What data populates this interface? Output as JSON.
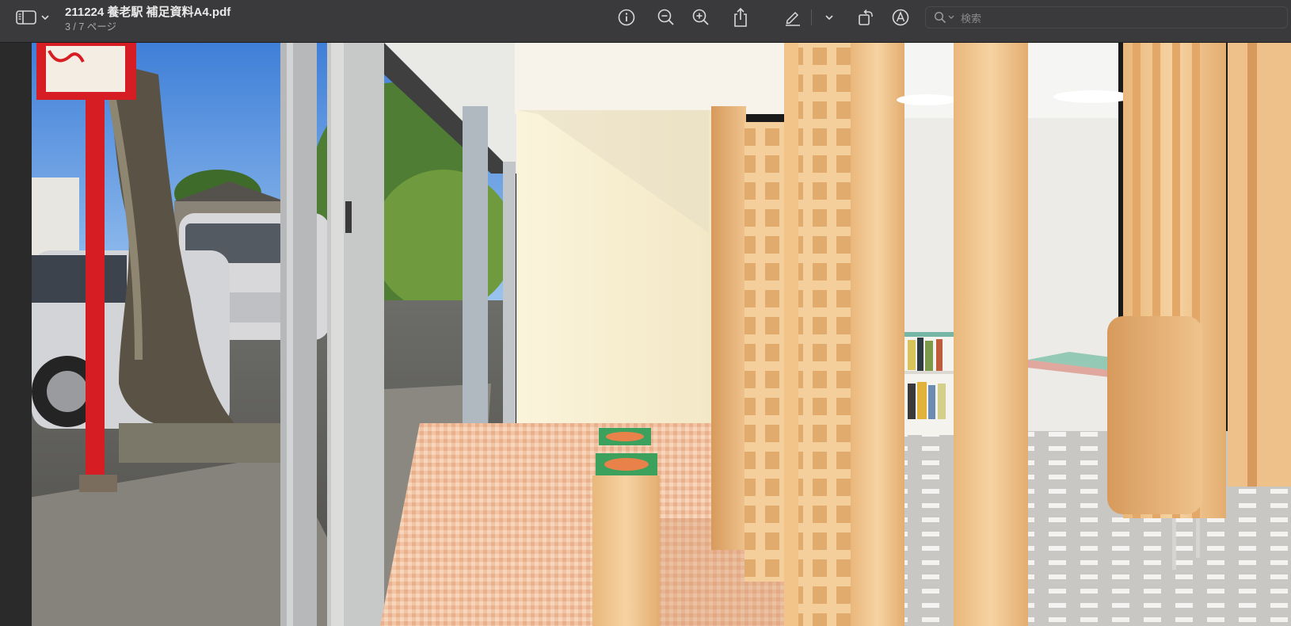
{
  "window": {
    "title": "211224 養老駅 補足資料A4.pdf",
    "page_indicator": "3 / 7 ページ"
  },
  "toolbar": {
    "icons": [
      "sidebar-icon",
      "chevron-down-icon",
      "info-icon",
      "zoom-out-icon",
      "zoom-in-icon",
      "share-icon",
      "markup-pen-icon",
      "chevron-down-icon",
      "rotate-icon",
      "annotate-icon",
      "search-icon"
    ]
  },
  "search": {
    "placeholder": "検索",
    "value": ""
  },
  "document": {
    "content": "photograph of a station street edge merged with a rendering of a wooden lattice arcade and interior"
  },
  "colors": {
    "toolbar_bg": "#3a3a3c",
    "toolbar_text": "#e9e9e9",
    "icon": "#d8d8d8"
  }
}
